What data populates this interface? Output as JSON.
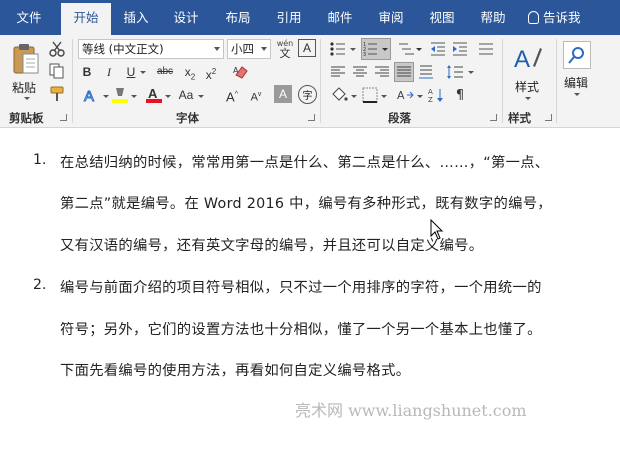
{
  "tabs": [
    "文件",
    "开始",
    "插入",
    "设计",
    "布局",
    "引用",
    "邮件",
    "审阅",
    "视图",
    "帮助"
  ],
  "active_tab": "开始",
  "tell_me": "告诉我",
  "clipboard": {
    "paste_label": "粘贴",
    "group_label": "剪贴板"
  },
  "font": {
    "name": "等线 (中文正文)",
    "size": "小四",
    "wen_label": "wén",
    "wen_char": "文",
    "border_char": "A",
    "group_label": "字体",
    "phonetic_char": "字",
    "aa_label": "Aa"
  },
  "paragraph": {
    "group_label": "段落"
  },
  "styles": {
    "label": "样式",
    "group_label": "样式"
  },
  "editing": {
    "label": "编辑"
  },
  "colors": {
    "ribbon_bg": "#2b579a",
    "highlight": "#ffff00",
    "font_color": "#e81123"
  },
  "document": {
    "items": [
      {
        "number": "1.",
        "lines": [
          "在总结归纳的时候，常常用第一点是什么、第二点是什么、……，“第一点、",
          "第二点”就是编号。在 Word 2016 中，编号有多种形式，既有数字的编号，",
          "又有汉语的编号，还有英文字母的编号，并且还可以自定义编号。"
        ]
      },
      {
        "number": "2.",
        "lines": [
          "编号与前面介绍的项目符号相似，只不过一个用排序的字符，一个用统一的",
          "符号；另外，它们的设置方法也十分相似，懂了一个另一个基本上也懂了。",
          "下面先看编号的使用方法，再看如何自定义编号格式。"
        ]
      }
    ],
    "watermark": "亮术网 www.liangshunet.com"
  }
}
